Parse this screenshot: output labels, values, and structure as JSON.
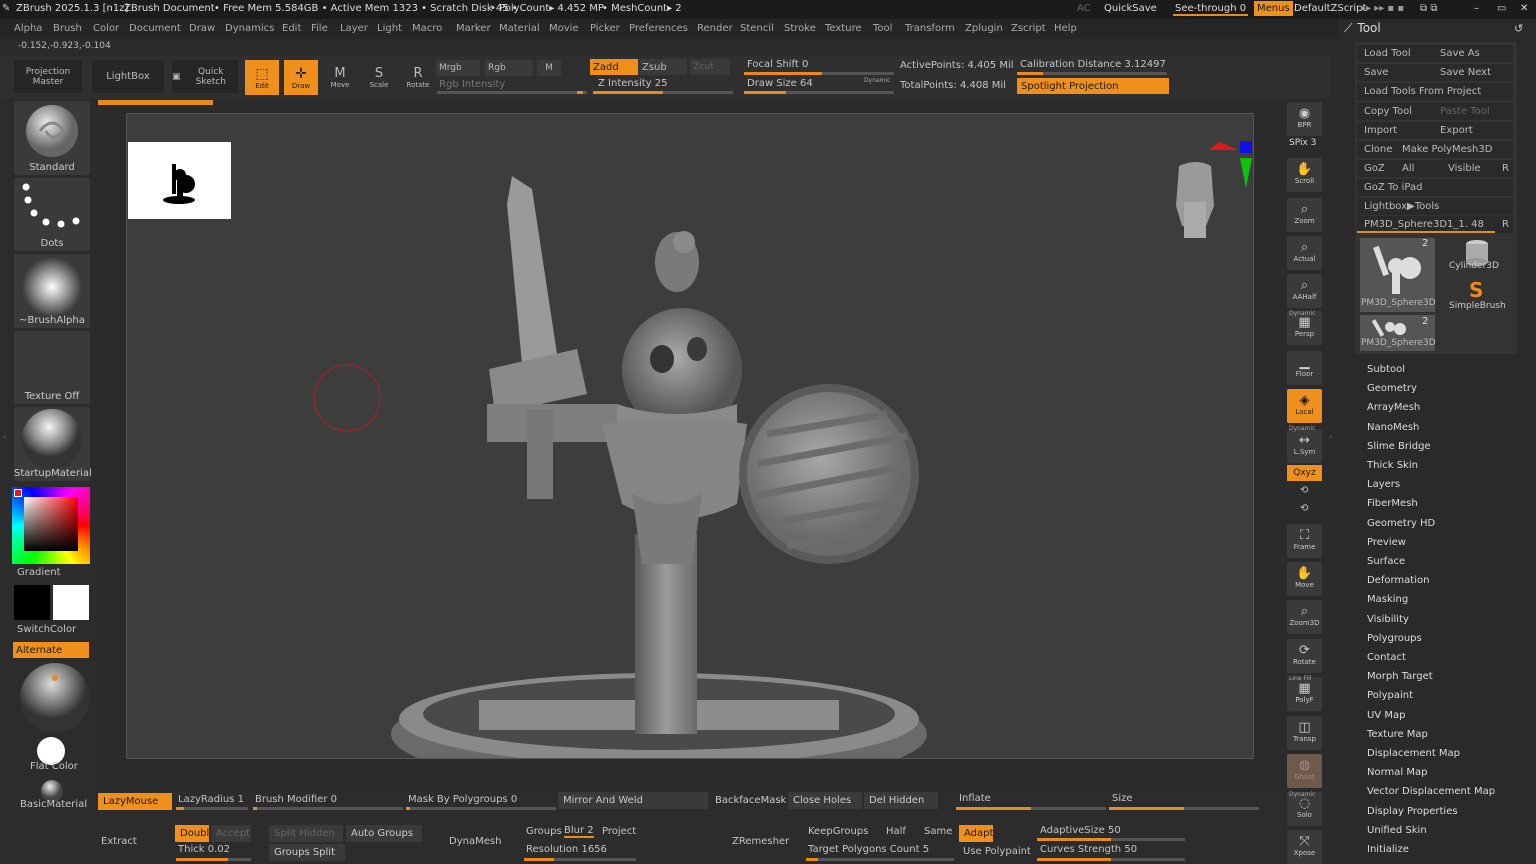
{
  "titlebar": {
    "app": "ZBrush 2025.1.3 [n1z]",
    "doc": "ZBrush Document",
    "mem": "• Free Mem 5.584GB • Active Mem 1323 • Scratch Disk 45 •",
    "poly": "• PolyCount▸ 4.452 MP",
    "mesh": "• MeshCount▸ 2",
    "ac": "AC",
    "quicksave": "QuickSave",
    "seethrough": "See-through",
    "seethrough_val": "0",
    "menus": "Menus",
    "zscript": "DefaultZScript"
  },
  "menubar": [
    "Alpha",
    "Brush",
    "Color",
    "Document",
    "Draw",
    "Dynamics",
    "Edit",
    "File",
    "Layer",
    "Light",
    "Macro",
    "Marker",
    "Material",
    "Movie",
    "Picker",
    "Preferences",
    "Render",
    "Stencil",
    "Stroke",
    "Texture",
    "Tool",
    "Transform",
    "Zplugin",
    "Zscript",
    "Help"
  ],
  "coords": "-0.152,-0.923,-0.104",
  "topshelf": {
    "projection": "Projection Master",
    "lightbox": "LightBox",
    "quicksketch": "Quick Sketch",
    "edit": "Edit",
    "draw": "Draw",
    "move": "Move",
    "scale": "Scale",
    "rotate": "Rotate",
    "mrgb": "Mrgb",
    "rgb": "Rgb",
    "m": "M",
    "rgb_intensity": "Rgb Intensity",
    "zadd": "Zadd",
    "zsub": "Zsub",
    "zcut": "Zcut",
    "z_intensity_label": "Z Intensity",
    "z_intensity_val": "25",
    "focal_shift_label": "Focal Shift",
    "focal_shift_val": "0",
    "draw_size_label": "Draw Size",
    "draw_size_val": "64",
    "dynamic": "Dynamic",
    "active_points": "ActivePoints: 4.405 Mil",
    "total_points": "TotalPoints: 4.408 Mil",
    "calibration": "Calibration Distance",
    "calibration_val": "3.12497",
    "spotlight": "Spotlight Projection"
  },
  "leftshelf": {
    "standard": "Standard",
    "dots": "Dots",
    "brushalpha": "~BrushAlpha",
    "textureoff": "Texture Off",
    "startupmaterial": "StartupMaterial",
    "gradient": "Gradient",
    "switchcolor": "SwitchColor",
    "alternate": "Alternate",
    "flatcolor": "Flat Color",
    "basicmaterial": "BasicMaterial"
  },
  "rightshelf": {
    "bpr": "BPR",
    "spix": "SPix 3",
    "scroll": "Scroll",
    "zoom": "Zoom",
    "actual": "Actual",
    "aahalf": "AAHalf",
    "dynamic_persp": "Dynamic",
    "persp": "Persp",
    "floor": "Floor",
    "local": "Local",
    "dynamic2": "Dynamic",
    "lsym": "L.Sym",
    "xyz": "Qxyz",
    "frame": "Frame",
    "move": "Move",
    "zoom3d": "Zoom3D",
    "rotate": "Rotate",
    "linefill": "Line Fill",
    "polyf": "PolyF",
    "transp": "Transp",
    "ghost": "Ghost",
    "dynamic3": "Dynamic",
    "solo": "Solo",
    "xpose": "Xpose"
  },
  "toolpanel": {
    "title": "Tool",
    "load_tool": "Load Tool",
    "save_as": "Save As",
    "save": "Save",
    "save_next": "Save Next",
    "load_from_project": "Load Tools From Project",
    "copy_tool": "Copy Tool",
    "paste_tool": "Paste Tool",
    "import": "Import",
    "export": "Export",
    "clone": "Clone",
    "make_polymesh": "Make PolyMesh3D",
    "goz": "GoZ",
    "all": "All",
    "visible": "Visible",
    "r": "R",
    "goz_ipad": "GoZ To iPad",
    "lightbox_tools": "Lightbox▶Tools",
    "current_tool": "PM3D_Sphere3D1_1. 48",
    "r2": "R",
    "thumb1": "PM3D_Sphere3D",
    "thumb1_count": "2",
    "thumb2": "Cylinder3D",
    "thumb3": "SimpleBrush",
    "thumb4": "PM3D_Sphere3D",
    "thumb4_count": "2",
    "menu": [
      "Subtool",
      "Geometry",
      "ArrayMesh",
      "NanoMesh",
      "Slime Bridge",
      "Thick Skin",
      "Layers",
      "FiberMesh",
      "Geometry HD",
      "Preview",
      "Surface",
      "Deformation",
      "Masking",
      "Visibility",
      "Polygroups",
      "Contact",
      "Morph Target",
      "Polypaint",
      "UV Map",
      "Texture Map",
      "Displacement Map",
      "Normal Map",
      "Vector Displacement Map",
      "Display Properties",
      "Unified Skin",
      "Initialize"
    ]
  },
  "bottom": {
    "lazymouse": "LazyMouse",
    "lazyradius": "LazyRadius",
    "lazyradius_val": "1",
    "brush_modifier": "Brush Modifier",
    "brush_modifier_val": "0",
    "mask_polygroups": "Mask By Polygroups",
    "mask_polygroups_val": "0",
    "mirror_weld": "Mirror And Weld",
    "backface": "BackfaceMask",
    "close_holes": "Close Holes",
    "del_hidden": "Del Hidden",
    "inflate": "Inflate",
    "size": "Size",
    "extract": "Extract",
    "double": "Double",
    "accept": "Accept",
    "thick": "Thick",
    "thick_val": "0.02",
    "split_hidden": "Split Hidden",
    "groups_split": "Groups Split",
    "auto_groups": "Auto Groups",
    "dynamesh": "DynaMesh",
    "groups": "Groups",
    "blur": "Blur",
    "blur_val": "2",
    "project": "Project",
    "resolution": "Resolution",
    "resolution_val": "1656",
    "zremesher": "ZRemesher",
    "keepgroups": "KeepGroups",
    "half": "Half",
    "same": "Same",
    "adapt": "Adapt",
    "target_polys": "Target Polygons Count",
    "target_polys_val": "5",
    "use_polypaint": "Use Polypaint",
    "adaptive_size": "AdaptiveSize",
    "adaptive_size_val": "50",
    "curves_strength": "Curves Strength",
    "curves_strength_val": "50"
  },
  "colors": {
    "accent": "#f0901c",
    "panel": "#2c2c2c",
    "canvas": "#3d3d3d"
  }
}
